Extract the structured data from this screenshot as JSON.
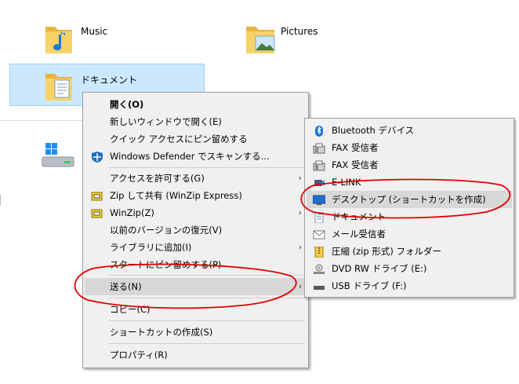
{
  "folders": {
    "music": "Music",
    "pictures": "Pictures",
    "documents": "ドキュメント"
  },
  "context_menu": {
    "items": [
      {
        "label": "開く(O)",
        "bold": true
      },
      {
        "label": "新しいウィンドウで開く(E)"
      },
      {
        "label": "クイック アクセスにピン留めする"
      },
      {
        "label": "Windows Defender でスキャンする...",
        "icon": "defender-shield-icon"
      },
      {
        "label": "アクセスを許可する(G)",
        "submenu": true
      },
      {
        "label": "Zip して共有 (WinZip Express)",
        "icon": "winzip-icon"
      },
      {
        "label": "WinZip(Z)",
        "icon": "winzip-icon",
        "submenu": true
      },
      {
        "label": "以前のバージョンの復元(V)"
      },
      {
        "label": "ライブラリに追加(I)",
        "submenu": true
      },
      {
        "label": "スタートにピン留めする(P)"
      },
      {
        "label": "送る(N)",
        "submenu": true,
        "highlighted": true
      },
      {
        "label": "コピー(C)"
      },
      {
        "label": "ショートカットの作成(S)"
      },
      {
        "label": "プロパティ(R)"
      }
    ],
    "arrow": "›"
  },
  "send_to_menu": {
    "items": [
      {
        "label": "Bluetooth デバイス",
        "icon": "bluetooth-icon"
      },
      {
        "label": "FAX 受信者",
        "icon": "fax-icon"
      },
      {
        "label": "FAX 受信者",
        "icon": "fax-icon"
      },
      {
        "label": "E-LINK",
        "icon": "e-link-icon"
      },
      {
        "label": "デスクトップ (ショートカットを作成)",
        "icon": "desktop-icon",
        "highlighted": true
      },
      {
        "label": "ドキュメント",
        "icon": "document-icon"
      },
      {
        "label": "メール受信者",
        "icon": "mail-icon"
      },
      {
        "label": "圧縮 (zip 形式) フォルダー",
        "icon": "zip-folder-icon"
      },
      {
        "label": "DVD RW ドライブ (E:)",
        "icon": "dvd-drive-icon"
      },
      {
        "label": "USB ドライブ (F:)",
        "icon": "usb-drive-icon"
      }
    ]
  },
  "colors": {
    "selection": "#cce8ff",
    "menu_bg": "#f0f0f0",
    "menu_highlight": "#d8d8d8",
    "annotation": "#e00000",
    "folder_yellow": "#f7c948"
  }
}
